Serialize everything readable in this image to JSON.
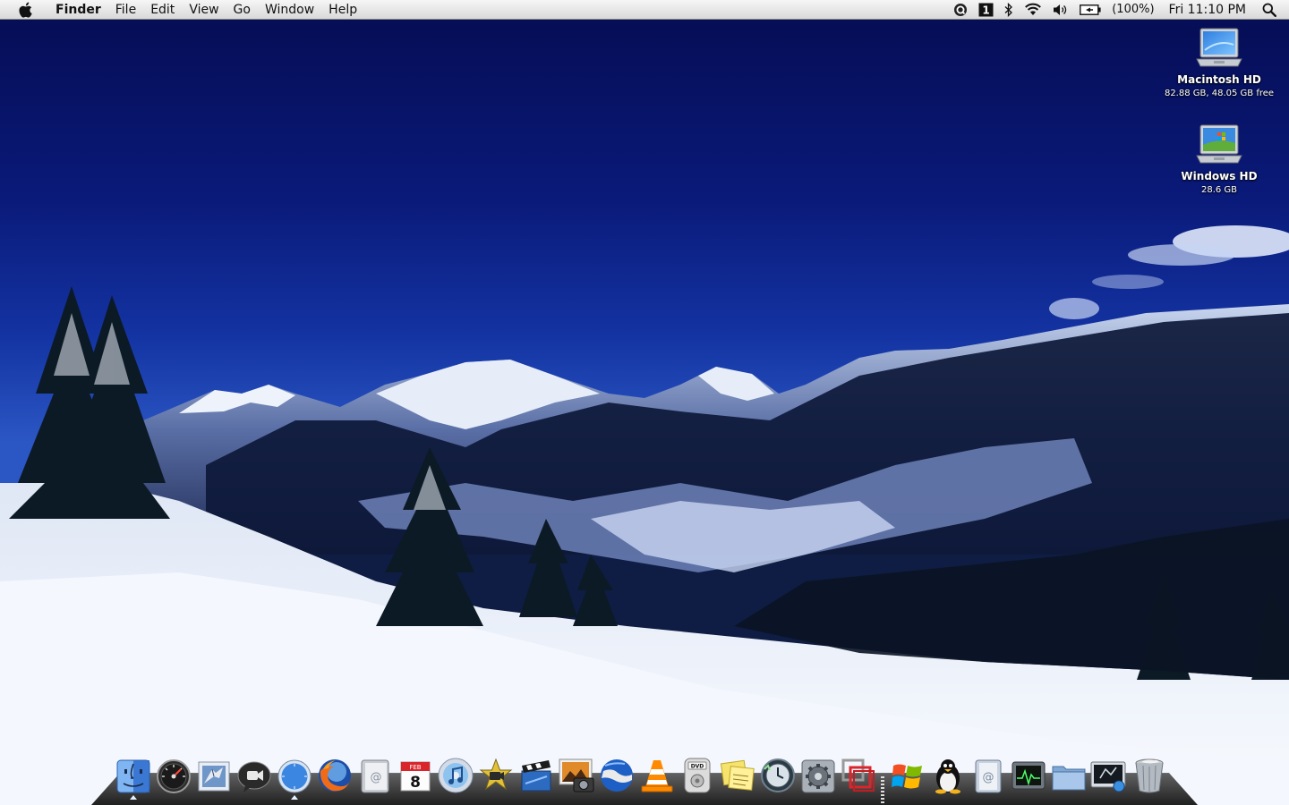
{
  "menubar": {
    "apple_icon": "apple-logo-icon",
    "menus": [
      "Finder",
      "File",
      "Edit",
      "View",
      "Go",
      "Window",
      "Help"
    ],
    "status_icons": [
      "quicksilver-icon",
      "spaces-icon",
      "bluetooth-icon",
      "wifi-icon",
      "volume-icon",
      "battery-icon"
    ],
    "battery_percent": "(100%)",
    "clock": "Fri 11:10 PM",
    "spotlight_icon": "spotlight-search-icon"
  },
  "desktop": {
    "icons": [
      {
        "name": "Macintosh HD",
        "info": "82.88 GB, 48.05 GB free",
        "icon": "laptop-drive-icon"
      },
      {
        "name": "Windows HD",
        "info": "28.6 GB",
        "icon": "windows-drive-icon"
      }
    ]
  },
  "dock": {
    "apps": [
      {
        "name": "Finder",
        "icon": "finder-icon",
        "running": true
      },
      {
        "name": "Dashboard",
        "icon": "dashboard-icon",
        "running": false
      },
      {
        "name": "Mail",
        "icon": "mail-icon",
        "running": false
      },
      {
        "name": "iChat",
        "icon": "ichat-icon",
        "running": false
      },
      {
        "name": "Safari",
        "icon": "safari-icon",
        "running": true
      },
      {
        "name": "Firefox",
        "icon": "firefox-icon",
        "running": false
      },
      {
        "name": "Address Book",
        "icon": "address-book-icon",
        "running": false
      },
      {
        "name": "iCal",
        "icon": "ical-icon",
        "running": false
      },
      {
        "name": "iTunes",
        "icon": "itunes-icon",
        "running": false
      },
      {
        "name": "iMovie",
        "icon": "imovie-icon",
        "running": false
      },
      {
        "name": "Final Cut",
        "icon": "clapper-icon",
        "running": false
      },
      {
        "name": "iPhoto",
        "icon": "iphoto-icon",
        "running": false
      },
      {
        "name": "Google Earth",
        "icon": "google-earth-icon",
        "running": false
      },
      {
        "name": "VLC",
        "icon": "vlc-cone-icon",
        "running": false
      },
      {
        "name": "DVD Player",
        "icon": "dvd-player-icon",
        "running": false
      },
      {
        "name": "Stickies",
        "icon": "stickies-icon",
        "running": false
      },
      {
        "name": "Time Machine",
        "icon": "time-machine-icon",
        "running": false
      },
      {
        "name": "System Preferences",
        "icon": "system-preferences-icon",
        "running": false
      },
      {
        "name": "Parallels",
        "icon": "parallels-icon",
        "running": false
      }
    ],
    "docs": [
      {
        "name": "Windows",
        "icon": "windows-logo-icon"
      },
      {
        "name": "Linux",
        "icon": "linux-tux-icon"
      },
      {
        "name": "Address Book",
        "icon": "address-card-icon"
      },
      {
        "name": "Activity Monitor",
        "icon": "activity-monitor-icon"
      },
      {
        "name": "Folder",
        "icon": "folder-icon"
      },
      {
        "name": "Screen Capture",
        "icon": "screen-capture-icon"
      },
      {
        "name": "Trash",
        "icon": "trash-icon"
      }
    ]
  }
}
